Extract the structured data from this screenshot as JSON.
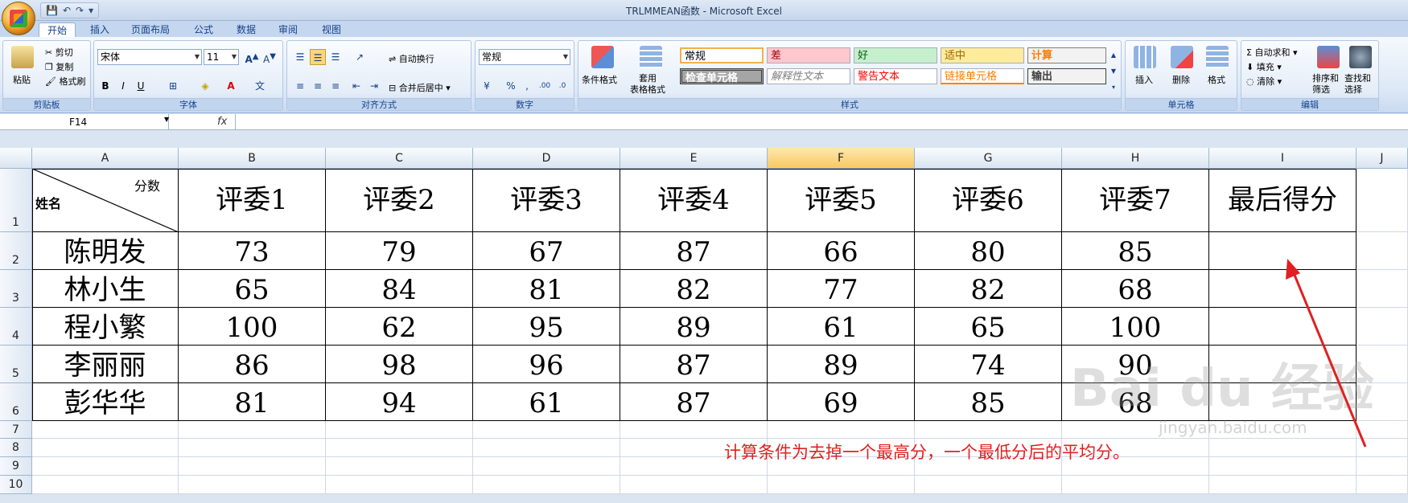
{
  "window": {
    "title": "TRLMMEAN函数 - Microsoft Excel"
  },
  "tabs": [
    "开始",
    "插入",
    "页面布局",
    "公式",
    "数据",
    "审阅",
    "视图"
  ],
  "clipboard": {
    "paste": "粘贴",
    "cut": "剪切",
    "copy": "复制",
    "format_painter": "格式刷",
    "label": "剪贴板"
  },
  "font": {
    "name": "宋体",
    "size": "11",
    "label": "字体"
  },
  "alignment": {
    "wrap": "自动换行",
    "merge": "合并后居中",
    "label": "对齐方式"
  },
  "number": {
    "format": "常规",
    "label": "数字"
  },
  "styles": {
    "cond_format": "条件格式",
    "table_format": "套用\n表格格式",
    "label": "样式",
    "cells": [
      "常规",
      "差",
      "好",
      "适中",
      "计算",
      "检查单元格",
      "解释性文本",
      "警告文本",
      "链接单元格",
      "输出"
    ]
  },
  "cells_group": {
    "insert": "插入",
    "delete": "删除",
    "format": "格式",
    "label": "单元格"
  },
  "editing": {
    "autosum": "自动求和",
    "fill": "填充",
    "clear": "清除",
    "sort": "排序和\n筛选",
    "find": "查找和\n选择",
    "label": "编辑"
  },
  "name_box": "F14",
  "formula_fx": "fx",
  "columns": [
    "A",
    "B",
    "C",
    "D",
    "E",
    "F",
    "G",
    "H",
    "I",
    "J"
  ],
  "rows": [
    "1",
    "2",
    "3",
    "4",
    "5",
    "6",
    "7",
    "8",
    "9",
    "10"
  ],
  "table": {
    "corner_top": "分数",
    "corner_bottom": "姓名",
    "headers": [
      "评委1",
      "评委2",
      "评委3",
      "评委4",
      "评委5",
      "评委6",
      "评委7",
      "最后得分"
    ],
    "rows": [
      {
        "name": "陈明发",
        "scores": [
          "73",
          "79",
          "67",
          "87",
          "66",
          "80",
          "85"
        ]
      },
      {
        "name": "林小生",
        "scores": [
          "65",
          "84",
          "81",
          "82",
          "77",
          "82",
          "68"
        ]
      },
      {
        "name": "程小繁",
        "scores": [
          "100",
          "62",
          "95",
          "89",
          "61",
          "65",
          "100"
        ]
      },
      {
        "name": "李丽丽",
        "scores": [
          "86",
          "98",
          "96",
          "87",
          "89",
          "74",
          "90"
        ]
      },
      {
        "name": "彭华华",
        "scores": [
          "81",
          "94",
          "61",
          "87",
          "69",
          "85",
          "68"
        ]
      }
    ]
  },
  "annotation": "计算条件为去掉一个最高分，一个最低分后的平均分。",
  "watermark": {
    "main": "Bai du 经验",
    "sub": "jingyan.baidu.com"
  },
  "colors": {
    "accent_red": "#e02020",
    "selected_col": "#f9c85f"
  }
}
